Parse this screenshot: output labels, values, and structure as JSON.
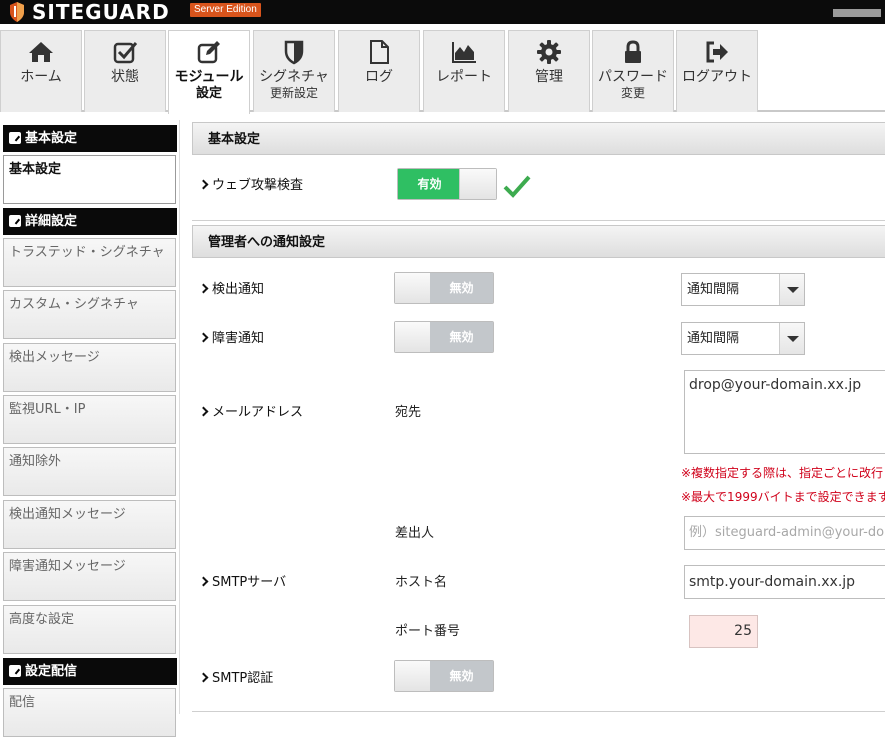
{
  "header": {
    "brand": "SITEGUARD",
    "edition": "Server Edition"
  },
  "tabs": [
    {
      "label": "ホーム",
      "label2": "",
      "icon": "home-icon"
    },
    {
      "label": "状態",
      "label2": "",
      "icon": "check-square-icon"
    },
    {
      "label": "モジュール",
      "label2": "設定",
      "icon": "edit-icon"
    },
    {
      "label": "シグネチャ",
      "label2": "更新設定",
      "icon": "shield-icon"
    },
    {
      "label": "ログ",
      "label2": "",
      "icon": "file-icon"
    },
    {
      "label": "レポート",
      "label2": "",
      "icon": "area-chart-icon"
    },
    {
      "label": "管理",
      "label2": "",
      "icon": "gear-icon"
    },
    {
      "label": "パスワード",
      "label2": "変更",
      "icon": "lock-icon"
    },
    {
      "label": "ログアウト",
      "label2": "",
      "icon": "sign-out-icon"
    }
  ],
  "sidebar": {
    "sections": [
      {
        "title": "基本設定",
        "items": [
          "基本設定"
        ]
      },
      {
        "title": "詳細設定",
        "items": [
          "トラステッド・シグネチャ",
          "カスタム・シグネチャ",
          "検出メッセージ",
          "監視URL・IP",
          "通知除外",
          "検出通知メッセージ",
          "障害通知メッセージ",
          "高度な設定"
        ]
      },
      {
        "title": "設定配信",
        "items": [
          "配信"
        ]
      }
    ]
  },
  "main": {
    "basic": {
      "title": "基本設定",
      "web_check_label": "ウェブ攻撃検査",
      "web_check_state": "有効"
    },
    "notify": {
      "title": "管理者への通知設定",
      "detect_label": "検出通知",
      "detect_state": "無効",
      "detect_interval": "通知間隔",
      "fault_label": "障害通知",
      "fault_state": "無効",
      "fault_interval": "通知間隔",
      "mail_label": "メールアドレス",
      "to_label": "宛先",
      "to_value": "drop@your-domain.xx.jp",
      "note1": "※複数指定する際は、指定ごとに改行してください",
      "note2": "※最大で1999バイトまで設定できます",
      "from_label": "差出人",
      "from_placeholder": "例）siteguard-admin@your-domain.xx.jp",
      "smtp_label": "SMTPサーバ",
      "host_label": "ホスト名",
      "host_value": "smtp.your-domain.xx.jp",
      "port_label": "ポート番号",
      "port_value": "25",
      "auth_label": "SMTP認証",
      "auth_state": "無効"
    }
  },
  "colors": {
    "toggle_on": "#2fbf63",
    "toggle_off": "#c3c7cb",
    "warning_text": "#d0021b",
    "edition_badge": "#d8541c"
  }
}
